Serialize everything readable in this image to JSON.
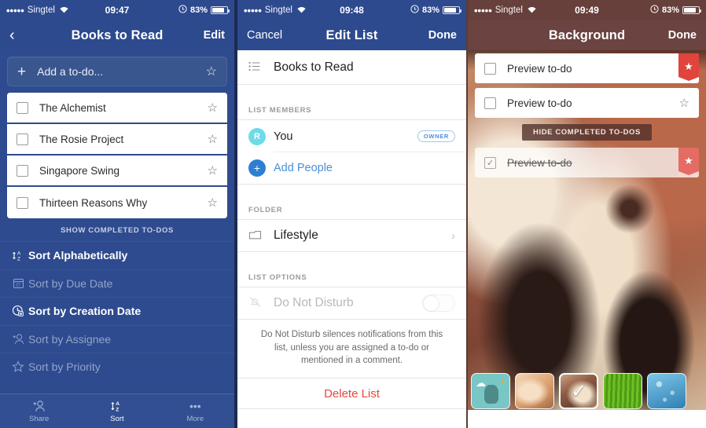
{
  "panel1": {
    "status": {
      "dots": "•••••",
      "carrier": "Singtel",
      "wifi": "▼",
      "time": "09:47",
      "alarm": "⏱",
      "battery_pct": "83%"
    },
    "nav": {
      "back": "‹",
      "title": "Books to Read",
      "right": "Edit"
    },
    "add_todo": {
      "plus": "+",
      "placeholder": "Add a to-do...",
      "star": "☆"
    },
    "todos": [
      {
        "title": "The Alchemist",
        "star": "☆",
        "checked": false
      },
      {
        "title": "The Rosie Project",
        "star": "☆",
        "checked": false
      },
      {
        "title": "Singapore Swing",
        "star": "☆",
        "checked": false
      },
      {
        "title": "Thirteen Reasons Why",
        "star": "☆",
        "checked": false
      }
    ],
    "show_completed": "SHOW COMPLETED TO-DOS",
    "sort_options": [
      {
        "label": "Sort Alphabetically",
        "icon": "sort-az-icon",
        "glyph": "⇅",
        "active": true
      },
      {
        "label": "Sort by Due Date",
        "icon": "calendar-icon",
        "glyph": "▤",
        "active": false
      },
      {
        "label": "Sort by Creation Date",
        "icon": "clock-icon",
        "glyph": "◕",
        "active": false
      },
      {
        "label": "Sort by Assignee",
        "icon": "person-add-icon",
        "glyph": "⚇",
        "active": false
      },
      {
        "label": "Sort by Priority",
        "icon": "star-icon",
        "glyph": "☆",
        "active": false
      }
    ],
    "tabs": [
      {
        "label": "Share",
        "icon": "person-add-icon",
        "glyph": "⚇",
        "active": false
      },
      {
        "label": "Sort",
        "icon": "sort-az-icon",
        "glyph": "⇅",
        "active": true
      },
      {
        "label": "More",
        "icon": "ellipsis-icon",
        "glyph": "•••",
        "active": false
      }
    ]
  },
  "panel2": {
    "status": {
      "dots": "•••••",
      "carrier": "Singtel",
      "wifi": "▼",
      "time": "09:48",
      "alarm": "⏱",
      "battery_pct": "83%"
    },
    "nav": {
      "left": "Cancel",
      "title": "Edit List",
      "right": "Done"
    },
    "list_name": {
      "value": "Books to Read",
      "icon": "list-icon",
      "glyph": "☰"
    },
    "members_header": "LIST MEMBERS",
    "members": [
      {
        "name": "You",
        "initial": "R",
        "badge": "OWNER"
      }
    ],
    "add_people": {
      "label": "Add People",
      "plus": "+"
    },
    "folder_header": "FOLDER",
    "folder": {
      "name": "Lifestyle",
      "icon": "folder-icon",
      "glyph": "🗀",
      "chevron": "›"
    },
    "options_header": "LIST OPTIONS",
    "do_not_disturb": {
      "label": "Do Not Disturb",
      "icon": "bell-slash-icon",
      "glyph": "⃠",
      "enabled": false
    },
    "help_text": "Do Not Disturb silences notifications from this list, unless you are assigned a to-do or mentioned in a comment.",
    "delete_list": "Delete List"
  },
  "panel3": {
    "status": {
      "dots": "•••••",
      "carrier": "Singtel",
      "wifi": "▼",
      "time": "09:49",
      "alarm": "⏱",
      "battery_pct": "83%"
    },
    "nav": {
      "title": "Background",
      "right": "Done"
    },
    "preview_rows": [
      {
        "title": "Preview to-do",
        "checked": false,
        "flagged": true,
        "star": "★"
      },
      {
        "title": "Preview to-do",
        "checked": false,
        "flagged": false,
        "star": "☆"
      }
    ],
    "hide_completed": "HIDE COMPLETED TO-DOS",
    "completed_row": {
      "title": "Preview to-do",
      "checked": true,
      "check": "✓",
      "flagged": true,
      "star": "★"
    },
    "thumbnails": [
      {
        "name": "illustration-thumbnail",
        "selected": false
      },
      {
        "name": "cat-thumbnail",
        "selected": false
      },
      {
        "name": "dog-thumbnail",
        "selected": true,
        "check": "✓"
      },
      {
        "name": "grass-thumbnail",
        "selected": false
      },
      {
        "name": "raindrops-thumbnail",
        "selected": false
      }
    ]
  },
  "colors": {
    "blue_nav": "#2d4a8e",
    "brown_nav": "#6b4340",
    "accent_blue": "#4a90d9",
    "delete_red": "#e8453c",
    "flag_red": "#e0443c",
    "avatar_cyan": "#6ddbe8"
  }
}
